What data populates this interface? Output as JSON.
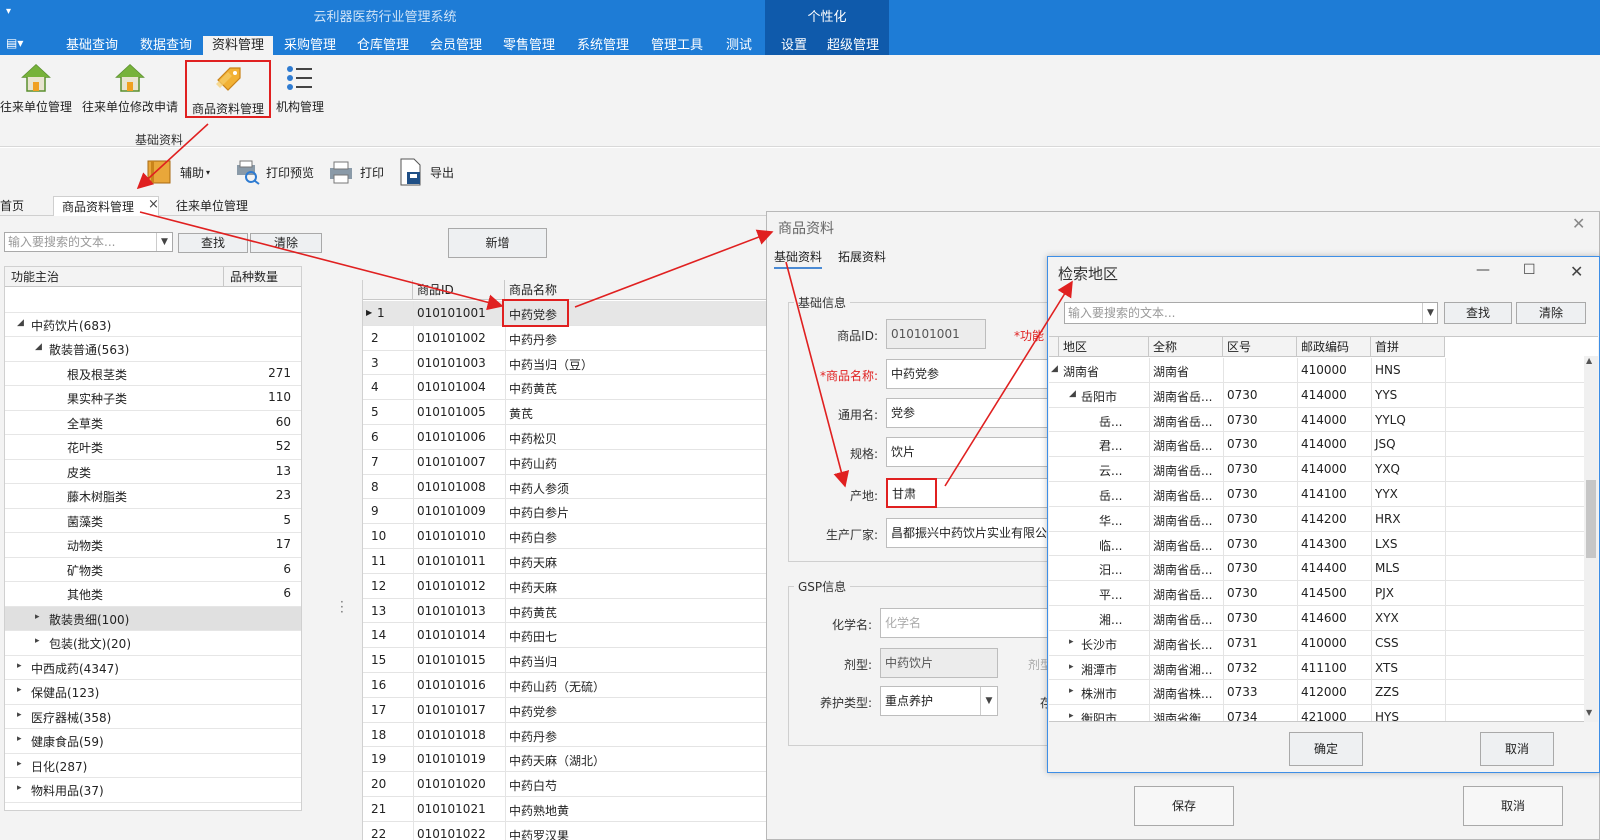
{
  "app": {
    "title": "云利器医药行业管理系统",
    "personalize": "个性化"
  },
  "ribbon_tabs": [
    "基础查询",
    "数据查询",
    "资料管理",
    "采购管理",
    "仓库管理",
    "会员管理",
    "零售管理",
    "系统管理",
    "管理工具",
    "测试",
    "设置",
    "超级管理"
  ],
  "ribbon_active_tab": "资料管理",
  "ribbon_buttons": [
    "往来单位管理",
    "往来单位修改申请",
    "商品资料管理",
    "机构管理"
  ],
  "ribbon_group": "基础资料",
  "toolbar": {
    "assist": "辅助",
    "print_preview": "打印预览",
    "print": "打印",
    "export": "导出"
  },
  "doc_tabs": {
    "home": "首页",
    "goods": "商品资料管理",
    "partners": "往来单位管理"
  },
  "left": {
    "search_placeholder": "输入要搜索的文本...",
    "find": "查找",
    "clear": "清除",
    "col_category": "功能主治",
    "col_count": "品种数量",
    "rows": [
      {
        "name": "",
        "count": ""
      },
      {
        "name": "中药饮片(683)",
        "count": ""
      },
      {
        "name": "散装普通(563)",
        "count": ""
      },
      {
        "name": "根及根茎类",
        "count": "271"
      },
      {
        "name": "果实种子类",
        "count": "110"
      },
      {
        "name": "全草类",
        "count": "60"
      },
      {
        "name": "花叶类",
        "count": "52"
      },
      {
        "name": "皮类",
        "count": "13"
      },
      {
        "name": "藤木树脂类",
        "count": "23"
      },
      {
        "name": "菌藻类",
        "count": "5"
      },
      {
        "name": "动物类",
        "count": "17"
      },
      {
        "name": "矿物类",
        "count": "6"
      },
      {
        "name": "其他类",
        "count": "6"
      },
      {
        "name": "散装贵细(100)",
        "count": ""
      },
      {
        "name": "包装(批文)(20)",
        "count": ""
      },
      {
        "name": "中西成药(4347)",
        "count": ""
      },
      {
        "name": "保健品(123)",
        "count": ""
      },
      {
        "name": "医疗器械(358)",
        "count": ""
      },
      {
        "name": "健康食品(59)",
        "count": ""
      },
      {
        "name": "日化(287)",
        "count": ""
      },
      {
        "name": "物料用品(37)",
        "count": ""
      }
    ]
  },
  "goods": {
    "new_button": "新增",
    "col_id": "商品ID",
    "col_name": "商品名称",
    "rows": [
      {
        "no": "1",
        "id": "010101001",
        "name": "中药党参"
      },
      {
        "no": "2",
        "id": "010101002",
        "name": "中药丹参"
      },
      {
        "no": "3",
        "id": "010101003",
        "name": "中药当归（豆）"
      },
      {
        "no": "4",
        "id": "010101004",
        "name": "中药黄芪"
      },
      {
        "no": "5",
        "id": "010101005",
        "name": "黄芪"
      },
      {
        "no": "6",
        "id": "010101006",
        "name": "中药松贝"
      },
      {
        "no": "7",
        "id": "010101007",
        "name": "中药山药"
      },
      {
        "no": "8",
        "id": "010101008",
        "name": "中药人参须"
      },
      {
        "no": "9",
        "id": "010101009",
        "name": "中药白参片"
      },
      {
        "no": "10",
        "id": "010101010",
        "name": "中药白参"
      },
      {
        "no": "11",
        "id": "010101011",
        "name": "中药天麻"
      },
      {
        "no": "12",
        "id": "010101012",
        "name": "中药天麻"
      },
      {
        "no": "13",
        "id": "010101013",
        "name": "中药黄芪"
      },
      {
        "no": "14",
        "id": "010101014",
        "name": "中药田七"
      },
      {
        "no": "15",
        "id": "010101015",
        "name": "中药当归"
      },
      {
        "no": "16",
        "id": "010101016",
        "name": "中药山药（无硫）"
      },
      {
        "no": "17",
        "id": "010101017",
        "name": "中药党参"
      },
      {
        "no": "18",
        "id": "010101018",
        "name": "中药丹参"
      },
      {
        "no": "19",
        "id": "010101019",
        "name": "中药天麻（湖北）"
      },
      {
        "no": "20",
        "id": "010101020",
        "name": "中药白芍"
      },
      {
        "no": "21",
        "id": "010101021",
        "name": "中药熟地黄"
      },
      {
        "no": "22",
        "id": "010101022",
        "name": "中药罗汉果"
      }
    ]
  },
  "goods_dialog": {
    "title": "商品资料",
    "tabs": [
      "基础资料",
      "拓展资料"
    ],
    "basic_group": "基础信息",
    "gsp_group": "GSP信息",
    "fields": {
      "goods_id_label": "商品ID:",
      "goods_id": "010101001",
      "func_label": "*功能",
      "goods_name_label": "*商品名称:",
      "goods_name": "中药党参",
      "common_name_label": "通用名:",
      "common_name": "党参",
      "spec_label": "规格:",
      "spec": "饮片",
      "origin_label": "产地:",
      "origin": "甘肃",
      "maker_label": "生产厂家:",
      "maker": "昌都振兴中药饮片实业有限公司",
      "chem_label": "化学名:",
      "chem_placeholder": "化学名",
      "form_label": "剂型:",
      "form": "中药饮片",
      "form_label2": "剂型",
      "care_label": "养护类型:",
      "care": "重点养护",
      "extra_label": "存"
    },
    "save": "保存",
    "cancel": "取消"
  },
  "region_dialog": {
    "title": "检索地区",
    "search_placeholder": "输入要搜索的文本...",
    "find": "查找",
    "clear": "清除",
    "columns": [
      "地区",
      "全称",
      "区号",
      "邮政编码",
      "首拼"
    ],
    "rows": [
      {
        "region": "湖南省",
        "full": "湖南省",
        "code": "",
        "zip": "410000",
        "py": "HNS"
      },
      {
        "region": "岳阳市",
        "full": "湖南省岳...",
        "code": "0730",
        "zip": "414000",
        "py": "YYS"
      },
      {
        "region": "岳...",
        "full": "湖南省岳...",
        "code": "0730",
        "zip": "414000",
        "py": "YYLQ"
      },
      {
        "region": "君...",
        "full": "湖南省岳...",
        "code": "0730",
        "zip": "414000",
        "py": "JSQ"
      },
      {
        "region": "云...",
        "full": "湖南省岳...",
        "code": "0730",
        "zip": "414000",
        "py": "YXQ"
      },
      {
        "region": "岳...",
        "full": "湖南省岳...",
        "code": "0730",
        "zip": "414100",
        "py": "YYX"
      },
      {
        "region": "华...",
        "full": "湖南省岳...",
        "code": "0730",
        "zip": "414200",
        "py": "HRX"
      },
      {
        "region": "临...",
        "full": "湖南省岳...",
        "code": "0730",
        "zip": "414300",
        "py": "LXS"
      },
      {
        "region": "汨...",
        "full": "湖南省岳...",
        "code": "0730",
        "zip": "414400",
        "py": "MLS"
      },
      {
        "region": "平...",
        "full": "湖南省岳...",
        "code": "0730",
        "zip": "414500",
        "py": "PJX"
      },
      {
        "region": "湘...",
        "full": "湖南省岳...",
        "code": "0730",
        "zip": "414600",
        "py": "XYX"
      },
      {
        "region": "长沙市",
        "full": "湖南省长...",
        "code": "0731",
        "zip": "410000",
        "py": "CSS"
      },
      {
        "region": "湘潭市",
        "full": "湖南省湘...",
        "code": "0732",
        "zip": "411100",
        "py": "XTS"
      },
      {
        "region": "株洲市",
        "full": "湖南省株...",
        "code": "0733",
        "zip": "412000",
        "py": "ZZS"
      },
      {
        "region": "衡阳市",
        "full": "湖南省衡...",
        "code": "0734",
        "zip": "421000",
        "py": "HYS"
      }
    ],
    "ok": "确定",
    "cancel": "取消"
  },
  "colors": {
    "title_bar": "#1e7cd6",
    "personal_block": "#0f5aab",
    "highlight": "#e02020",
    "dialog_border": "#3d8ee6"
  }
}
